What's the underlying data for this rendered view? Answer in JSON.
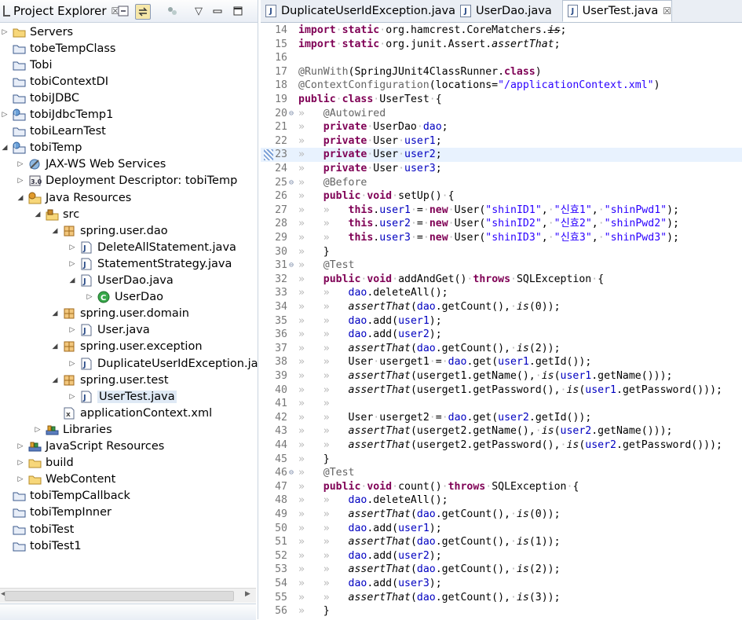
{
  "left_panel": {
    "tab_title": "Project Explorer",
    "tab_close": "☒",
    "tree": [
      {
        "label": "Servers",
        "depth": 0,
        "arrow": "▷",
        "icon": "folder"
      },
      {
        "label": "tobeTempClass",
        "depth": 0,
        "arrow": "",
        "icon": "project"
      },
      {
        "label": "Tobi",
        "depth": 0,
        "arrow": "",
        "icon": "project"
      },
      {
        "label": "tobiContextDI",
        "depth": 0,
        "arrow": "",
        "icon": "project"
      },
      {
        "label": "tobiJDBC",
        "depth": 0,
        "arrow": "",
        "icon": "project"
      },
      {
        "label": "tobiJdbcTemp1",
        "depth": 0,
        "arrow": "▷",
        "icon": "web-project"
      },
      {
        "label": "tobiLearnTest",
        "depth": 0,
        "arrow": "",
        "icon": "project"
      },
      {
        "label": "tobiTemp",
        "depth": 0,
        "arrow": "◢",
        "icon": "web-project"
      },
      {
        "label": "JAX-WS Web Services",
        "depth": 1,
        "arrow": "▷",
        "icon": "web-services"
      },
      {
        "label": "Deployment Descriptor: tobiTemp",
        "depth": 1,
        "arrow": "▷",
        "icon": "descriptor"
      },
      {
        "label": "Java Resources",
        "depth": 1,
        "arrow": "◢",
        "icon": "java-resources"
      },
      {
        "label": "src",
        "depth": 2,
        "arrow": "◢",
        "icon": "source-folder"
      },
      {
        "label": "spring.user.dao",
        "depth": 3,
        "arrow": "◢",
        "icon": "package"
      },
      {
        "label": "DeleteAllStatement.java",
        "depth": 4,
        "arrow": "▷",
        "icon": "java-file"
      },
      {
        "label": "StatementStrategy.java",
        "depth": 4,
        "arrow": "▷",
        "icon": "java-file"
      },
      {
        "label": "UserDao.java",
        "depth": 4,
        "arrow": "◢",
        "icon": "java-file"
      },
      {
        "label": "UserDao",
        "depth": 5,
        "arrow": "▷",
        "icon": "class"
      },
      {
        "label": "spring.user.domain",
        "depth": 3,
        "arrow": "◢",
        "icon": "package"
      },
      {
        "label": "User.java",
        "depth": 4,
        "arrow": "▷",
        "icon": "java-file"
      },
      {
        "label": "spring.user.exception",
        "depth": 3,
        "arrow": "◢",
        "icon": "package"
      },
      {
        "label": "DuplicateUserIdException.java",
        "depth": 4,
        "arrow": "▷",
        "icon": "java-file"
      },
      {
        "label": "spring.user.test",
        "depth": 3,
        "arrow": "◢",
        "icon": "package"
      },
      {
        "label": "UserTest.java",
        "depth": 4,
        "arrow": "▷",
        "icon": "java-file",
        "selected": true
      },
      {
        "label": "applicationContext.xml",
        "depth": 3,
        "arrow": "",
        "icon": "xml-file"
      },
      {
        "label": "Libraries",
        "depth": 2,
        "arrow": "▷",
        "icon": "library"
      },
      {
        "label": "JavaScript Resources",
        "depth": 1,
        "arrow": "▷",
        "icon": "library"
      },
      {
        "label": "build",
        "depth": 1,
        "arrow": "▷",
        "icon": "folder"
      },
      {
        "label": "WebContent",
        "depth": 1,
        "arrow": "▷",
        "icon": "folder"
      },
      {
        "label": "tobiTempCallback",
        "depth": 0,
        "arrow": "",
        "icon": "project"
      },
      {
        "label": "tobiTempInner",
        "depth": 0,
        "arrow": "",
        "icon": "project"
      },
      {
        "label": "tobiTest",
        "depth": 0,
        "arrow": "",
        "icon": "project"
      },
      {
        "label": "tobiTest1",
        "depth": 0,
        "arrow": "",
        "icon": "project"
      }
    ]
  },
  "editor": {
    "tabs": [
      {
        "label": "DuplicateUserIdException.java",
        "active": false
      },
      {
        "label": "UserDao.java",
        "active": false
      },
      {
        "label": "UserTest.java",
        "active": true
      }
    ],
    "tab_close": "☒",
    "highlighted_line": 23,
    "lines": [
      {
        "n": "14",
        "fold": "",
        "html": "<span class=\"kw\">import</span><span class=\"dot\">·</span><span class=\"kw\">static</span><span class=\"dot\">·</span>org.hamcrest.CoreMatchers.<span class=\"it\"><s>is</s></span>;"
      },
      {
        "n": "15",
        "fold": "",
        "html": "<span class=\"kw\">import</span><span class=\"dot\">·</span><span class=\"kw\">static</span><span class=\"dot\">·</span>org.junit.Assert.<span class=\"it\">assertThat</span>;"
      },
      {
        "n": "16",
        "fold": "",
        "html": ""
      },
      {
        "n": "17",
        "fold": "",
        "html": "<span class=\"an\">@RunWith</span>(SpringJUnit4ClassRunner.<span class=\"kw\">class</span>)"
      },
      {
        "n": "18",
        "fold": "",
        "html": "<span class=\"an\">@ContextConfiguration</span>(locations=<span class=\"st\">\"/applicationContext.xml\"</span>)"
      },
      {
        "n": "19",
        "fold": "",
        "html": "<span class=\"kw\">public</span><span class=\"dot\">·</span><span class=\"kw\">class</span><span class=\"dot\">·</span>UserTest<span class=\"dot\">·</span>{"
      },
      {
        "n": "20",
        "fold": "⊖",
        "html": "<span class=\"tab\">»   </span><span class=\"an\">@Autowired</span>"
      },
      {
        "n": "21",
        "fold": "",
        "html": "<span class=\"tab\">»   </span><span class=\"kw\">private</span><span class=\"dot\">·</span>UserDao<span class=\"dot\">·</span><span class=\"fd\">dao</span>;"
      },
      {
        "n": "22",
        "fold": "",
        "html": "<span class=\"tab\">»   </span><span class=\"kw\">private</span><span class=\"dot\">·</span>User<span class=\"dot\">·</span><span class=\"fd\">user1</span>;"
      },
      {
        "n": "23",
        "fold": "",
        "html": "<span class=\"tab\">»   </span><span class=\"kw\">private</span><span class=\"dot\">·</span>User<span class=\"dot\">·</span><span class=\"fd\">user2</span>;"
      },
      {
        "n": "24",
        "fold": "",
        "html": "<span class=\"tab\">»   </span><span class=\"kw\">private</span><span class=\"dot\">·</span>User<span class=\"dot\">·</span><span class=\"fd\">user3</span>;"
      },
      {
        "n": "25",
        "fold": "⊖",
        "html": "<span class=\"tab\">»   </span><span class=\"an\">@Before</span>"
      },
      {
        "n": "26",
        "fold": "",
        "html": "<span class=\"tab\">»   </span><span class=\"kw\">public</span><span class=\"dot\">·</span><span class=\"kw\">void</span><span class=\"dot\">·</span>setUp()<span class=\"dot\">·</span>{"
      },
      {
        "n": "27",
        "fold": "",
        "html": "<span class=\"tab\">»   »   </span><span class=\"kw\">this</span>.<span class=\"fd\">user1</span><span class=\"dot\">·</span>=<span class=\"dot\">·</span><span class=\"kw\">new</span><span class=\"dot\">·</span>User(<span class=\"st\">\"shinID1\"</span>,<span class=\"dot\">·</span><span class=\"st\">\"신효1\"</span>,<span class=\"dot\">·</span><span class=\"st\">\"shinPwd1\"</span>);"
      },
      {
        "n": "28",
        "fold": "",
        "html": "<span class=\"tab\">»   »   </span><span class=\"kw\">this</span>.<span class=\"fd\">user2</span><span class=\"dot\">·</span>=<span class=\"dot\">·</span><span class=\"kw\">new</span><span class=\"dot\">·</span>User(<span class=\"st\">\"shinID2\"</span>,<span class=\"dot\">·</span><span class=\"st\">\"신효2\"</span>,<span class=\"dot\">·</span><span class=\"st\">\"shinPwd2\"</span>);"
      },
      {
        "n": "29",
        "fold": "",
        "html": "<span class=\"tab\">»   »   </span><span class=\"kw\">this</span>.<span class=\"fd\">user3</span><span class=\"dot\">·</span>=<span class=\"dot\">·</span><span class=\"kw\">new</span><span class=\"dot\">·</span>User(<span class=\"st\">\"shinID3\"</span>,<span class=\"dot\">·</span><span class=\"st\">\"신효3\"</span>,<span class=\"dot\">·</span><span class=\"st\">\"shinPwd3\"</span>);"
      },
      {
        "n": "30",
        "fold": "",
        "html": "<span class=\"tab\">»   </span>}"
      },
      {
        "n": "31",
        "fold": "⊖",
        "html": "<span class=\"tab\">»   </span><span class=\"an\">@Test</span>"
      },
      {
        "n": "32",
        "fold": "",
        "html": "<span class=\"tab\">»   </span><span class=\"kw\">public</span><span class=\"dot\">·</span><span class=\"kw\">void</span><span class=\"dot\">·</span>addAndGet()<span class=\"dot\">·</span><span class=\"kw\">throws</span><span class=\"dot\">·</span>SQLException<span class=\"dot\">·</span>{"
      },
      {
        "n": "33",
        "fold": "",
        "html": "<span class=\"tab\">»   »   </span><span class=\"fd\">dao</span>.deleteAll();"
      },
      {
        "n": "34",
        "fold": "",
        "html": "<span class=\"tab\">»   »   </span><span class=\"it\">assertThat</span>(<span class=\"fd\">dao</span>.getCount(),<span class=\"dot\">·</span><span class=\"it\">is</span>(0));"
      },
      {
        "n": "35",
        "fold": "",
        "html": "<span class=\"tab\">»   »   </span><span class=\"fd\">dao</span>.add(<span class=\"fd\">user1</span>);"
      },
      {
        "n": "36",
        "fold": "",
        "html": "<span class=\"tab\">»   »   </span><span class=\"fd\">dao</span>.add(<span class=\"fd\">user2</span>);"
      },
      {
        "n": "37",
        "fold": "",
        "html": "<span class=\"tab\">»   »   </span><span class=\"it\">assertThat</span>(<span class=\"fd\">dao</span>.getCount(),<span class=\"dot\">·</span><span class=\"it\">is</span>(2));"
      },
      {
        "n": "38",
        "fold": "",
        "html": "<span class=\"tab\">»   »   </span>User<span class=\"dot\">·</span>userget1<span class=\"dot\">·</span>=<span class=\"dot\">·</span><span class=\"fd\">dao</span>.get(<span class=\"fd\">user1</span>.getId());"
      },
      {
        "n": "39",
        "fold": "",
        "html": "<span class=\"tab\">»   »   </span><span class=\"it\">assertThat</span>(userget1.getName(),<span class=\"dot\">·</span><span class=\"it\">is</span>(<span class=\"fd\">user1</span>.getName()));"
      },
      {
        "n": "40",
        "fold": "",
        "html": "<span class=\"tab\">»   »   </span><span class=\"it\">assertThat</span>(userget1.getPassword(),<span class=\"dot\">·</span><span class=\"it\">is</span>(<span class=\"fd\">user1</span>.getPassword()));"
      },
      {
        "n": "41",
        "fold": "",
        "html": "<span class=\"tab\">»   »   </span>"
      },
      {
        "n": "42",
        "fold": "",
        "html": "<span class=\"tab\">»   »   </span>User<span class=\"dot\">·</span>userget2<span class=\"dot\">·</span>=<span class=\"dot\">·</span><span class=\"fd\">dao</span>.get(<span class=\"fd\">user2</span>.getId());"
      },
      {
        "n": "43",
        "fold": "",
        "html": "<span class=\"tab\">»   »   </span><span class=\"it\">assertThat</span>(userget2.getName(),<span class=\"dot\">·</span><span class=\"it\">is</span>(<span class=\"fd\">user2</span>.getName()));"
      },
      {
        "n": "44",
        "fold": "",
        "html": "<span class=\"tab\">»   »   </span><span class=\"it\">assertThat</span>(userget2.getPassword(),<span class=\"dot\">·</span><span class=\"it\">is</span>(<span class=\"fd\">user2</span>.getPassword()));"
      },
      {
        "n": "45",
        "fold": "",
        "html": "<span class=\"tab\">»   </span>}"
      },
      {
        "n": "46",
        "fold": "⊖",
        "html": "<span class=\"tab\">»   </span><span class=\"an\">@Test</span>"
      },
      {
        "n": "47",
        "fold": "",
        "html": "<span class=\"tab\">»   </span><span class=\"kw\">public</span><span class=\"dot\">·</span><span class=\"kw\">void</span><span class=\"dot\">·</span>count()<span class=\"dot\">·</span><span class=\"kw\">throws</span><span class=\"dot\">·</span>SQLException<span class=\"dot\">·</span>{"
      },
      {
        "n": "48",
        "fold": "",
        "html": "<span class=\"tab\">»   »   </span><span class=\"fd\">dao</span>.deleteAll();"
      },
      {
        "n": "49",
        "fold": "",
        "html": "<span class=\"tab\">»   »   </span><span class=\"it\">assertThat</span>(<span class=\"fd\">dao</span>.getCount(),<span class=\"dot\">·</span><span class=\"it\">is</span>(0));"
      },
      {
        "n": "50",
        "fold": "",
        "html": "<span class=\"tab\">»   »   </span><span class=\"fd\">dao</span>.add(<span class=\"fd\">user1</span>);"
      },
      {
        "n": "51",
        "fold": "",
        "html": "<span class=\"tab\">»   »   </span><span class=\"it\">assertThat</span>(<span class=\"fd\">dao</span>.getCount(),<span class=\"dot\">·</span><span class=\"it\">is</span>(1));"
      },
      {
        "n": "52",
        "fold": "",
        "html": "<span class=\"tab\">»   »   </span><span class=\"fd\">dao</span>.add(<span class=\"fd\">user2</span>);"
      },
      {
        "n": "53",
        "fold": "",
        "html": "<span class=\"tab\">»   »   </span><span class=\"it\">assertThat</span>(<span class=\"fd\">dao</span>.getCount(),<span class=\"dot\">·</span><span class=\"it\">is</span>(2));"
      },
      {
        "n": "54",
        "fold": "",
        "html": "<span class=\"tab\">»   »   </span><span class=\"fd\">dao</span>.add(<span class=\"fd\">user3</span>);"
      },
      {
        "n": "55",
        "fold": "",
        "html": "<span class=\"tab\">»   »   </span><span class=\"it\">assertThat</span>(<span class=\"fd\">dao</span>.getCount(),<span class=\"dot\">·</span><span class=\"it\">is</span>(3));"
      },
      {
        "n": "56",
        "fold": "",
        "html": "<span class=\"tab\">»   </span>}"
      }
    ]
  }
}
